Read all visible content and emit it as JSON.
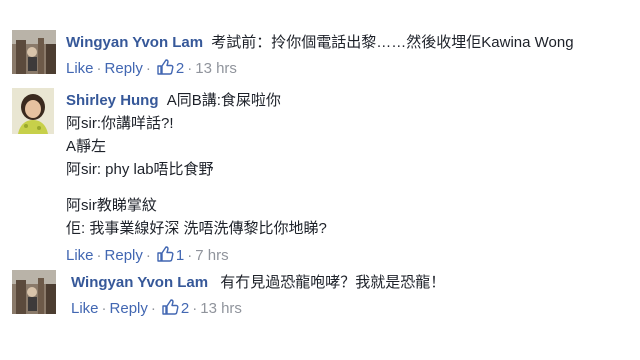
{
  "comments": [
    {
      "author": "Wingyan Yvon Lam",
      "lines": [
        "考試前：拎你個電話出黎……然後收埋佢Kawina Wong"
      ],
      "like_label": "Like",
      "reply_label": "Reply",
      "reaction_count": "2",
      "time": "13 hrs"
    },
    {
      "author": "Shirley Hung",
      "lines": [
        "A同B講:食屎啦你",
        "阿sir:你講咩話?!",
        "A靜左",
        "阿sir: phy lab唔比食野",
        "",
        "阿sir教睇掌紋",
        "佢: 我事業線好深 洗唔洗傳黎比你地睇?"
      ],
      "like_label": "Like",
      "reply_label": "Reply",
      "reaction_count": "1",
      "time": "7 hrs"
    },
    {
      "author": "Wingyan Yvon Lam",
      "lines": [
        "有冇見過恐龍咆哮？我就是恐龍！"
      ],
      "like_label": "Like",
      "reply_label": "Reply",
      "reaction_count": "2",
      "time": "13 hrs"
    }
  ],
  "colors": {
    "author": "#365899",
    "link": "#4267b2",
    "meta": "#90949c",
    "text": "#1d2129"
  },
  "icons": {
    "reaction": "thumbs-up-icon"
  }
}
